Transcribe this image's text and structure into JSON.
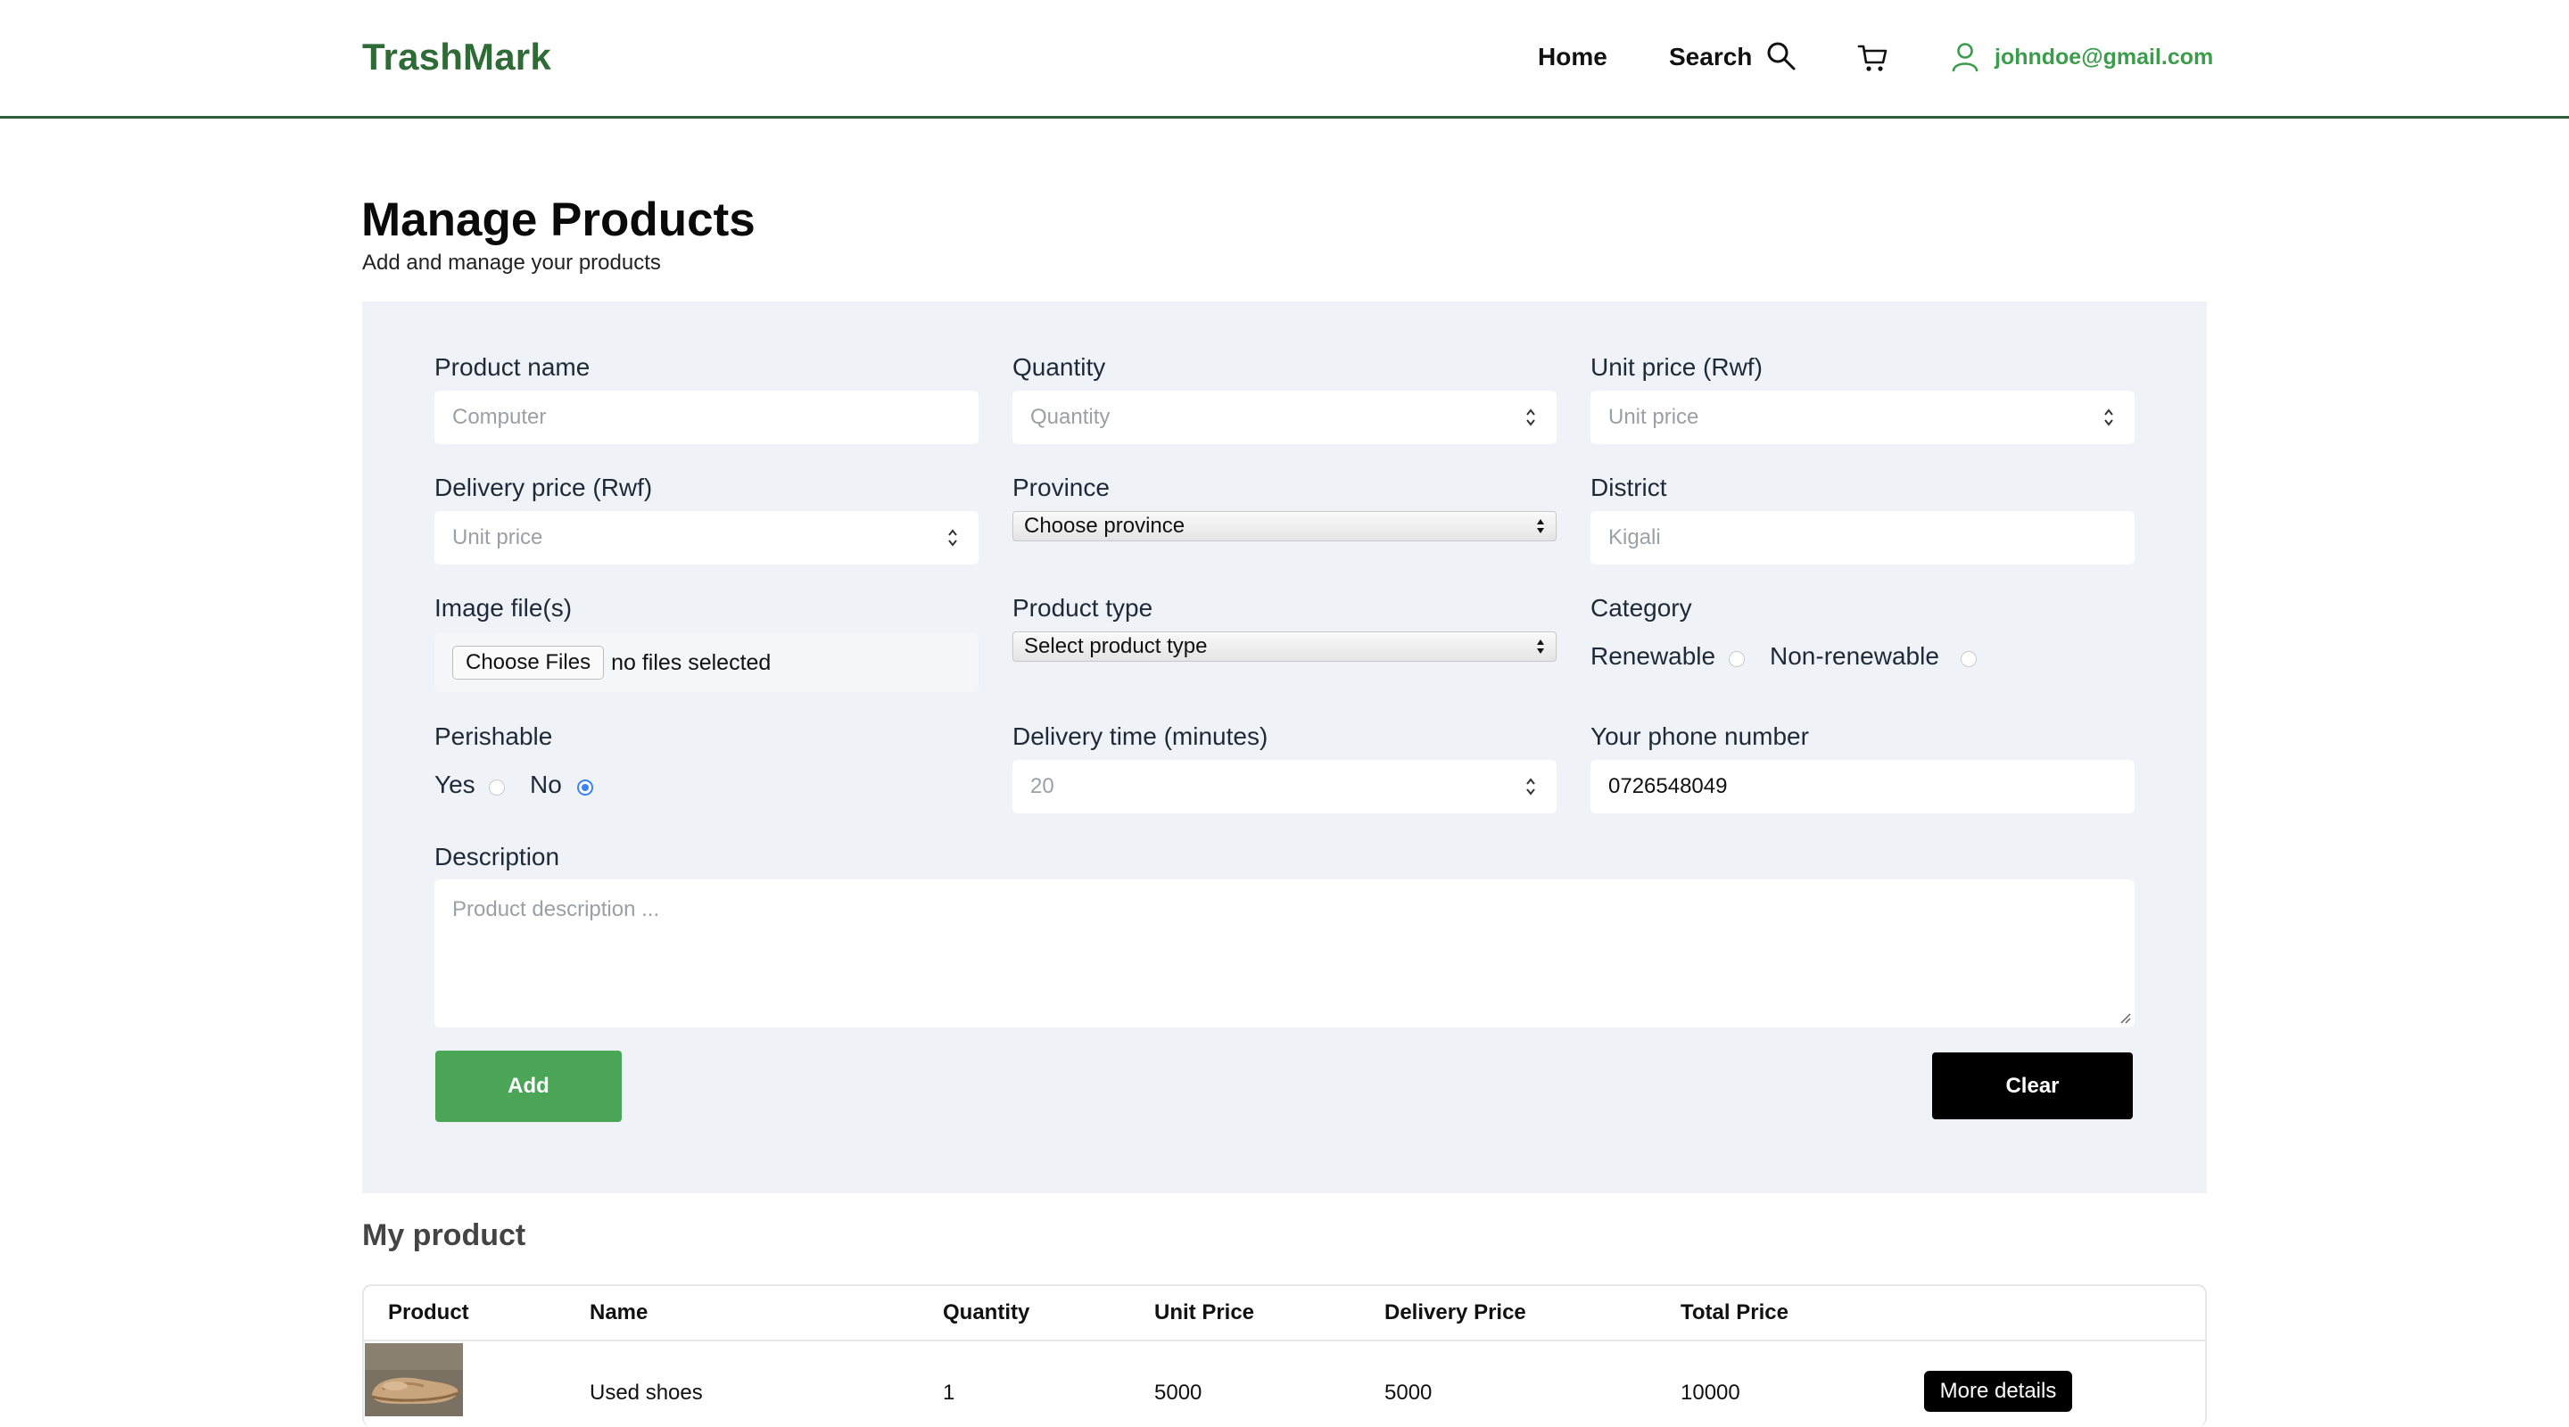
{
  "header": {
    "brand": "TrashMark",
    "nav": {
      "home": "Home",
      "search": "Search"
    },
    "user_email": "johndoe@gmail.com",
    "icons": [
      "search-icon",
      "cart-icon",
      "user-icon"
    ],
    "colors": {
      "brand": "#2e6b36",
      "email": "#3b9d4b",
      "border": "#2f5d3a"
    }
  },
  "page": {
    "title": "Manage Products",
    "subtitle": "Add and manage your products"
  },
  "form": {
    "product_name": {
      "label": "Product name",
      "placeholder": "Computer"
    },
    "quantity": {
      "label": "Quantity",
      "placeholder": "Quantity"
    },
    "unit_price": {
      "label": "Unit price (Rwf)",
      "placeholder": "Unit price"
    },
    "delivery_price": {
      "label": "Delivery price (Rwf)",
      "placeholder": "Unit price"
    },
    "province": {
      "label": "Province",
      "selected": "Choose province"
    },
    "district": {
      "label": "District",
      "placeholder": "Kigali"
    },
    "image_files": {
      "label": "Image file(s)",
      "button": "Choose Files",
      "status": "no files selected"
    },
    "product_type": {
      "label": "Product type",
      "selected": "Select product type"
    },
    "category": {
      "label": "Category",
      "options": [
        "Renewable",
        "Non-renewable"
      ],
      "selected": null
    },
    "perishable": {
      "label": "Perishable",
      "options": [
        "Yes",
        "No"
      ],
      "selected": "No"
    },
    "delivery_time": {
      "label": "Delivery time (minutes)",
      "placeholder": "20"
    },
    "phone": {
      "label": "Your phone number",
      "value": "0726548049"
    },
    "description": {
      "label": "Description",
      "placeholder": "Product description ..."
    },
    "add_label": "Add",
    "clear_label": "Clear",
    "colors": {
      "panel": "#eff3f8",
      "add": "#4aa557",
      "clear": "#000000",
      "radio_selected": "#3b82f6"
    }
  },
  "products": {
    "title": "My product",
    "columns": [
      "Product",
      "Name",
      "Quantity",
      "Unit Price",
      "Delivery Price",
      "Total Price"
    ],
    "rows": [
      {
        "name": "Used shoes",
        "quantity": "1",
        "unit_price": "5000",
        "delivery_price": "5000",
        "total_price": "10000",
        "action": "More details"
      }
    ]
  }
}
